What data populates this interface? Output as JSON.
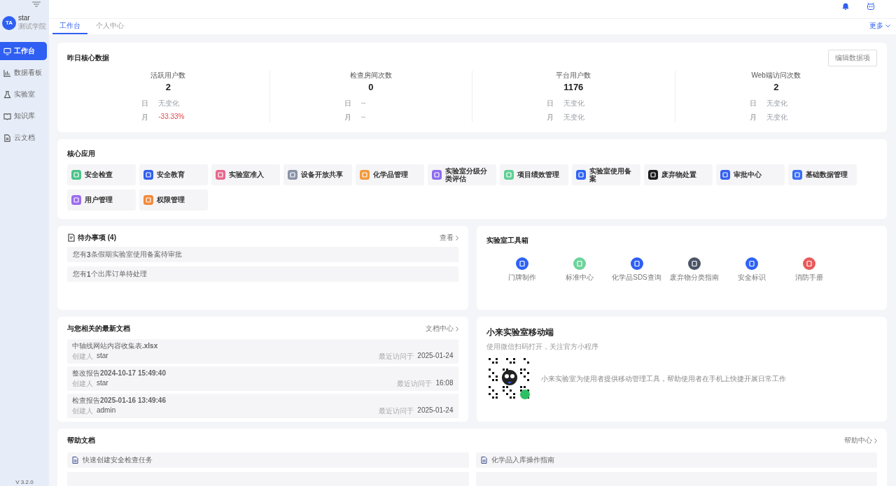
{
  "user": {
    "avatar": "TA",
    "name": "star",
    "org": "测试学院"
  },
  "sidebar": {
    "items": [
      {
        "label": "工作台",
        "selected": true
      },
      {
        "label": "数据看板",
        "selected": false
      },
      {
        "label": "实验室",
        "selected": false
      },
      {
        "label": "知识库",
        "selected": false
      },
      {
        "label": "云文档",
        "selected": false
      }
    ],
    "version": "V 3.2.0"
  },
  "tabs": [
    {
      "label": "工作台",
      "selected": true
    },
    {
      "label": "个人中心",
      "selected": false
    }
  ],
  "more": "更多",
  "core_data": {
    "title": "昨日核心数据",
    "edit_button": "编辑数据项",
    "stats": [
      {
        "label": "活跃用户数",
        "value": "2",
        "changes": [
          {
            "label": "日",
            "value": "无变化",
            "negative": false
          },
          {
            "label": "月",
            "value": "-33.33%",
            "negative": true
          }
        ]
      },
      {
        "label": "检查房间次数",
        "value": "0",
        "changes": [
          {
            "label": "日",
            "value": "--",
            "negative": false
          },
          {
            "label": "月",
            "value": "--",
            "negative": false
          }
        ]
      },
      {
        "label": "平台用户数",
        "value": "1176",
        "changes": [
          {
            "label": "日",
            "value": "无变化",
            "negative": false
          },
          {
            "label": "月",
            "value": "无变化",
            "negative": false
          }
        ]
      },
      {
        "label": "Web端访问次数",
        "value": "2",
        "changes": [
          {
            "label": "日",
            "value": "无变化",
            "negative": false
          },
          {
            "label": "月",
            "value": "无变化",
            "negative": false
          }
        ]
      }
    ]
  },
  "core_apps": {
    "title": "核心应用",
    "items": [
      {
        "label": "安全检查",
        "color": "#4cc38a"
      },
      {
        "label": "安全教育",
        "color": "#3360f0"
      },
      {
        "label": "实验室准入",
        "color": "#e8688e"
      },
      {
        "label": "设备开放共享",
        "color": "#8a93a6"
      },
      {
        "label": "化学品管理",
        "color": "#f29a3c"
      },
      {
        "label": "实验室分级分类评估",
        "color": "#8d6cf0"
      },
      {
        "label": "项目绩效管理",
        "color": "#5fcf94"
      },
      {
        "label": "实验室使用备案",
        "color": "#2f63f5"
      },
      {
        "label": "废弃物处置",
        "color": "#1c1c1c"
      },
      {
        "label": "审批中心",
        "color": "#3560f2"
      },
      {
        "label": "基础数据管理",
        "color": "#3a6cf4"
      },
      {
        "label": "用户管理",
        "color": "#9b6cf0"
      },
      {
        "label": "权限管理",
        "color": "#f08a3c"
      }
    ]
  },
  "todo": {
    "title": "待办事项 (4)",
    "link": "查看",
    "items": [
      "您有**3**条假期实验室使用备案待审批",
      "您有**1**个出库订单待处理"
    ]
  },
  "toolbox": {
    "title": "实验室工具箱",
    "items": [
      {
        "label": "门牌制作",
        "color": "#2f63f5"
      },
      {
        "label": "标准中心",
        "color": "#6fd39b"
      },
      {
        "label": "化学品SDS查询",
        "color": "#2f5ff2"
      },
      {
        "label": "废弃物分类指南",
        "color": "#4c5566"
      },
      {
        "label": "安全标识",
        "color": "#2f63f5"
      },
      {
        "label": "消防手册",
        "color": "#ea5a5a"
      }
    ]
  },
  "docs": {
    "title": "与您相关的最新文档",
    "link": "文档中心",
    "items": [
      {
        "name": "中轴线网站内容收集表**.xlsx**",
        "creator_label": "创建人",
        "creator": "star",
        "visit_label": "最近访问于",
        "visit": "2025-01-24"
      },
      {
        "name": "整改报告**2024-10-17 15:49:40**",
        "creator_label": "创建人",
        "creator": "star",
        "visit_label": "最近访问于",
        "visit": "16:08"
      },
      {
        "name": "检查报告**2025-01-16 13:49:46**",
        "creator_label": "创建人",
        "creator": "admin",
        "visit_label": "最近访问于",
        "visit": "2025-01-24"
      }
    ]
  },
  "mobile": {
    "title": "小来实验室移动端",
    "subtitle": "使用微信扫码打开，关注官方小程序",
    "description": "小来实验室为使用者提供移动管理工具，帮助使用者在手机上快捷开展日常工作"
  },
  "help": {
    "title": "帮助文档",
    "link": "帮助中心",
    "items": [
      "快速创建安全检查任务",
      "化学品入库操作指南"
    ]
  }
}
